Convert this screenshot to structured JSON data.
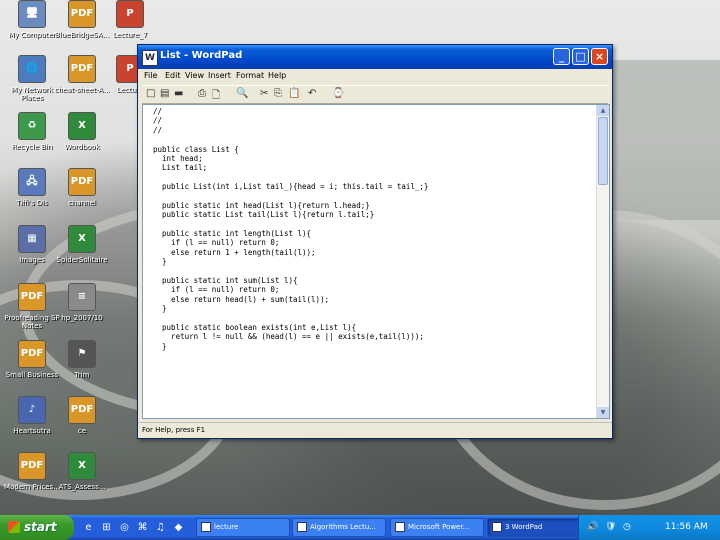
{
  "desktop": {
    "icons": [
      {
        "label": "My Computer",
        "glyph": "🖥",
        "color": "#6a8bbf"
      },
      {
        "label": "BlueBridgeSA...",
        "glyph": "PDF",
        "color": "#d9972a"
      },
      {
        "label": "Lecture_7",
        "glyph": "P",
        "color": "#c9442e"
      },
      {
        "label": "My Network Places",
        "glyph": "🌐",
        "color": "#4c7bc0"
      },
      {
        "label": "cheat-sheet-A...",
        "glyph": "PDF",
        "color": "#d9972a"
      },
      {
        "label": "Lecture",
        "glyph": "P",
        "color": "#c9442e"
      },
      {
        "label": "Recycle Bin",
        "glyph": "♻",
        "color": "#3c9a4a"
      },
      {
        "label": "Wordbook",
        "glyph": "X",
        "color": "#2f8a3c"
      },
      {
        "label": "Tiffi's DIs",
        "glyph": "🖧",
        "color": "#5a79b8"
      },
      {
        "label": "channel",
        "glyph": "PDF",
        "color": "#d9972a"
      },
      {
        "label": "Images",
        "glyph": "▦",
        "color": "#5a6fa8"
      },
      {
        "label": "SpiderSolitaire",
        "glyph": "X",
        "color": "#2f8a3c"
      },
      {
        "label": "Proofreading SP Notes",
        "glyph": "PDF",
        "color": "#d9972a"
      },
      {
        "label": "hp_2007/10",
        "glyph": "≡",
        "color": "#8a8a8a"
      },
      {
        "label": "Small Business",
        "glyph": "PDF",
        "color": "#d9972a"
      },
      {
        "label": "Trim",
        "glyph": "⚑",
        "color": "#555555"
      },
      {
        "label": "Heartsutra",
        "glyph": "♪",
        "color": "#4b66b0"
      },
      {
        "label": "ce",
        "glyph": "PDF",
        "color": "#d9972a"
      },
      {
        "label": "Modern Prices...",
        "glyph": "PDF",
        "color": "#d9972a"
      },
      {
        "label": "ATS_Assess...",
        "glyph": "X",
        "color": "#2f8a3c"
      }
    ]
  },
  "window": {
    "title": "List - WordPad",
    "app_icon": "W",
    "controls": {
      "minimize": "_",
      "maximize": "□",
      "close": "×"
    },
    "menu": [
      "File",
      "Edit",
      "View",
      "Insert",
      "Format",
      "Help"
    ],
    "toolbar_icons": [
      "□",
      "▤",
      "▬",
      "⎙",
      "🗋",
      "🔍",
      "✂",
      "⎘",
      "📋",
      "↶",
      "⌚"
    ],
    "document_lines": [
      "//",
      "//",
      "//",
      "",
      "public class List {",
      "  int head;",
      "  List tail;",
      "",
      "  public List(int i,List tail_){head = i; this.tail = tail_;}",
      "",
      "  public static int head(List l){return l.head;}",
      "  public static List tail(List l){return l.tail;}",
      "",
      "  public static int length(List l){",
      "    if (l == null) return 0;",
      "    else return 1 + length(tail(l));",
      "  }",
      "",
      "  public static int sum(List l){",
      "    if (l == null) return 0;",
      "    else return head(l) + sum(tail(l));",
      "  }",
      "",
      "  public static boolean exists(int e,List l){",
      "    return l != null && (head(l) == e || exists(e,tail(l)));",
      "  }"
    ],
    "status": "For Help, press F1"
  },
  "taskbar": {
    "start_label": "start",
    "quick_launch": [
      "e",
      "⊞",
      "◎",
      "⌘",
      "♫",
      "◆"
    ],
    "tasks": [
      {
        "label": "lecture",
        "active": false
      },
      {
        "label": "Algorithms Lectu...",
        "active": false
      },
      {
        "label": "Microsoft Power...",
        "active": false
      },
      {
        "label": "3 WordPad",
        "active": true
      }
    ],
    "tray": {
      "icons": [
        "🔊",
        "🛡",
        "◷"
      ],
      "time": "11:56 AM"
    }
  }
}
